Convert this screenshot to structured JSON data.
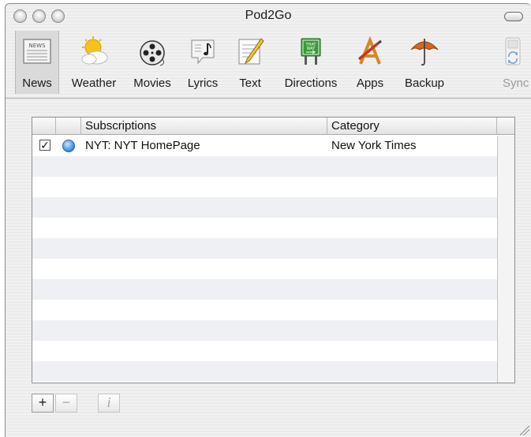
{
  "window": {
    "title": "Pod2Go"
  },
  "toolbar": {
    "items": [
      {
        "label": "News",
        "icon": "newspaper-icon",
        "selected": true
      },
      {
        "label": "Weather",
        "icon": "weather-sun-cloud-icon"
      },
      {
        "label": "Movies",
        "icon": "film-reel-icon"
      },
      {
        "label": "Lyrics",
        "icon": "lyrics-note-icon"
      },
      {
        "label": "Text",
        "icon": "text-notepad-icon"
      },
      {
        "label": "Directions",
        "icon": "directions-sign-icon"
      },
      {
        "label": "Apps",
        "icon": "apps-pencil-icon"
      },
      {
        "label": "Backup",
        "icon": "backup-umbrella-icon"
      },
      {
        "label": "Sync",
        "icon": "sync-ipod-icon",
        "disabled": true
      }
    ]
  },
  "table": {
    "columns": [
      "Subscriptions",
      "Category"
    ],
    "rows": [
      {
        "checked": true,
        "subscription": "NYT: NYT HomePage",
        "category": "New York Times"
      }
    ]
  },
  "buttons": {
    "add": "+",
    "remove": "−",
    "info": "i"
  },
  "colors": {
    "row_alt": "#eef0f3",
    "selected_tool_bg": "#dadada"
  }
}
